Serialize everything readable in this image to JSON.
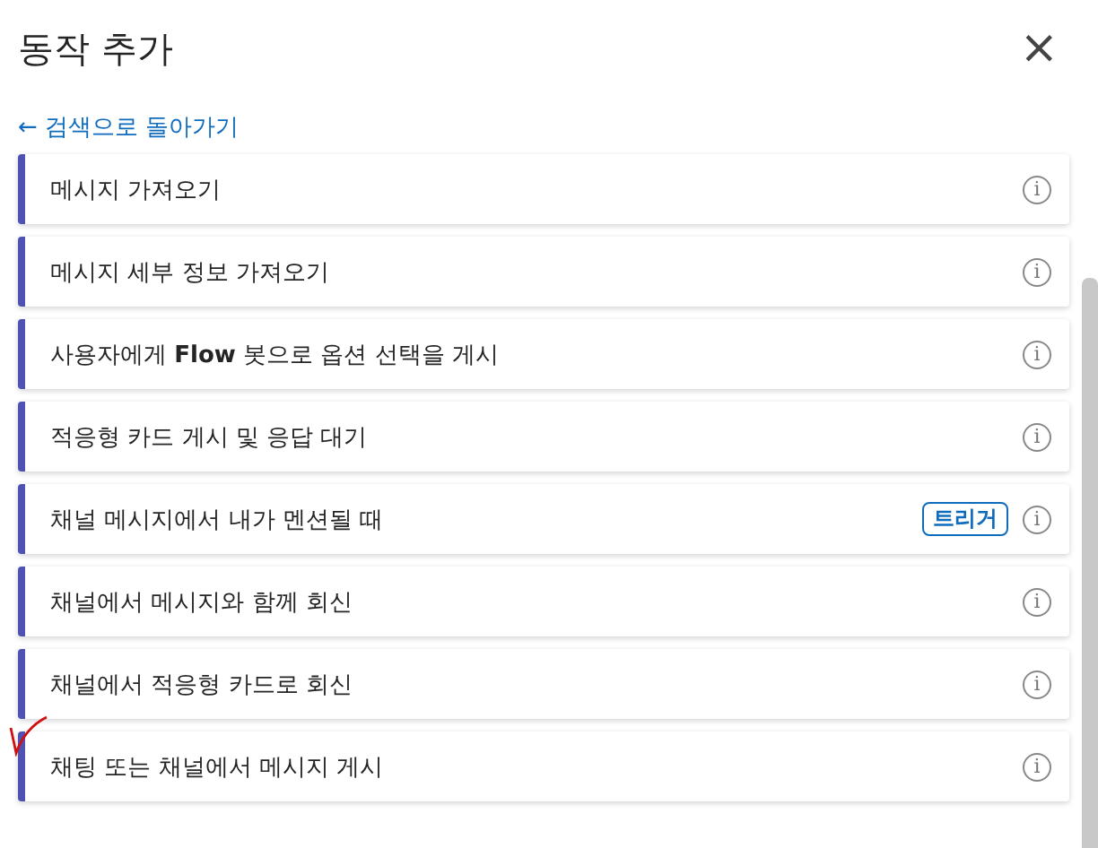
{
  "panel": {
    "title": "동작 추가",
    "close": "×"
  },
  "back_link": {
    "arrow": "←",
    "label": "검색으로 돌아가기"
  },
  "actions": [
    {
      "label": "메시지 가져오기",
      "info": "i"
    },
    {
      "label": "메시지 세부 정보 가져오기",
      "info": "i"
    },
    {
      "label": "사용자에게 **Flow** 봇으로 옵션 선택을 게시",
      "info": "i"
    },
    {
      "label": "적응형 카드 게시 및 응답 대기",
      "info": "i"
    },
    {
      "label": "채널 메시지에서 내가 멘션될 때",
      "badge": "트리거",
      "info": "i"
    },
    {
      "label": "채널에서 메시지와 함께 회신",
      "info": "i"
    },
    {
      "label": "채널에서 적응형 카드로 회신",
      "info": "i"
    },
    {
      "label": "채팅 또는 채널에서 메시지 게시",
      "info": "i",
      "annotated": true
    }
  ]
}
